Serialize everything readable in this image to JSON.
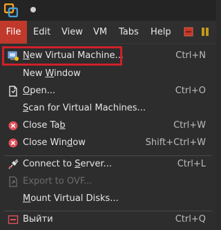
{
  "menubar": {
    "items": [
      {
        "label": "File",
        "active": true
      },
      {
        "label": "Edit",
        "active": false
      },
      {
        "label": "View",
        "active": false
      },
      {
        "label": "VM",
        "active": false
      },
      {
        "label": "Tabs",
        "active": false
      },
      {
        "label": "Help",
        "active": false
      }
    ]
  },
  "file_menu": {
    "new_vm": {
      "pre": "",
      "mnemonic": "N",
      "post": "ew Virtual Machine...",
      "shortcut": "Ctrl+N",
      "icon": "new-vm-icon"
    },
    "new_window": {
      "pre": "New ",
      "mnemonic": "W",
      "post": "indow",
      "shortcut": ""
    },
    "open": {
      "pre": "",
      "mnemonic": "O",
      "post": "pen...",
      "shortcut": "Ctrl+O",
      "icon": "open-file-icon"
    },
    "scan": {
      "pre": "",
      "mnemonic": "S",
      "post": "can for Virtual Machines...",
      "shortcut": ""
    },
    "close_tab": {
      "pre": "Close Ta",
      "mnemonic": "b",
      "post": "",
      "shortcut": "Ctrl+W",
      "icon": "close-icon"
    },
    "close_window": {
      "pre": "Close Win",
      "mnemonic": "d",
      "post": "ow",
      "shortcut": "Shift+Ctrl+W",
      "icon": "close-icon"
    },
    "connect": {
      "pre": "Connect to ",
      "mnemonic": "S",
      "post": "erver...",
      "shortcut": "Ctrl+L",
      "icon": "connect-icon"
    },
    "export_ovf": {
      "pre": "Export to OVF...",
      "mnemonic": "",
      "post": "",
      "shortcut": "",
      "disabled": true,
      "icon": "export-icon"
    },
    "mount_disks": {
      "pre": "",
      "mnemonic": "M",
      "post": "ount Virtual Disks...",
      "shortcut": ""
    },
    "exit": {
      "pre": "Выйти",
      "mnemonic": "",
      "post": "",
      "shortcut": "Ctrl+Q",
      "icon": "exit-icon"
    }
  },
  "colors": {
    "accent": "#c0392b",
    "highlight_border": "#d0202a"
  }
}
